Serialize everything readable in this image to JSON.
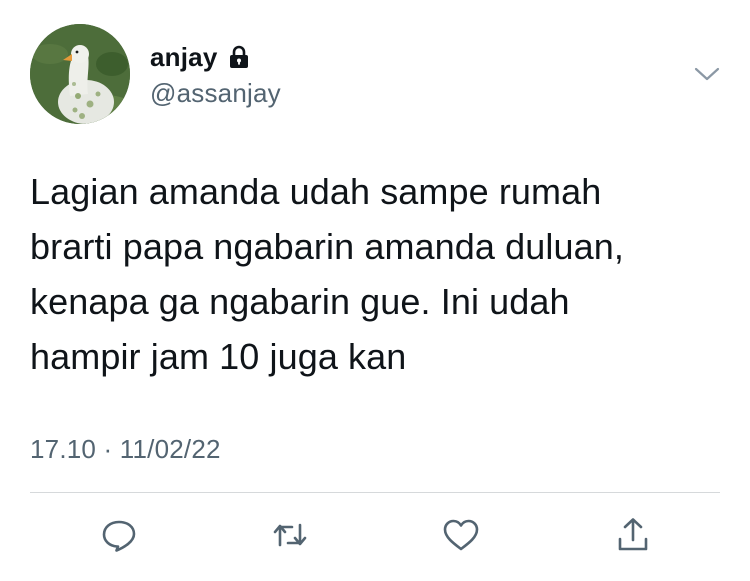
{
  "user": {
    "display_name": "anjay",
    "handle": "@assanjay",
    "protected_icon": "lock-icon",
    "avatar_icon": "duck-avatar"
  },
  "tweet": {
    "lines": [
      "Lagian amanda udah sampe rumah",
      "brarti papa ngabarin amanda duluan,",
      "kenapa ga ngabarin gue. Ini udah",
      "hampir jam 10 juga kan"
    ],
    "timestamp": "17.10 · 11/02/22"
  },
  "actions": {
    "reply_icon": "reply-icon",
    "retweet_icon": "retweet-icon",
    "like_icon": "heart-icon",
    "share_icon": "share-icon",
    "more_icon": "chevron-down-icon"
  },
  "colors": {
    "text": "#0f1419",
    "secondary": "#536471",
    "divider": "#d6d9db",
    "icon": "#536471"
  }
}
